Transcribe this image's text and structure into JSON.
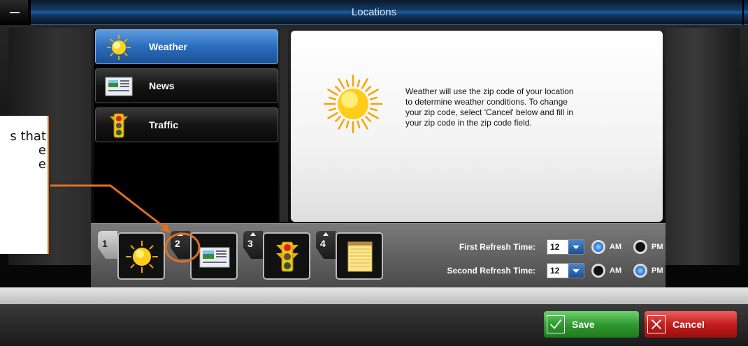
{
  "window": {
    "title": "Locations"
  },
  "feeds": [
    {
      "label": "Weather",
      "icon": "sun-icon",
      "selected": true
    },
    {
      "label": "News",
      "icon": "newspaper-icon",
      "selected": false
    },
    {
      "label": "Traffic",
      "icon": "traffic-light-icon",
      "selected": false
    }
  ],
  "description": {
    "lines": [
      "Weather will use the zip code of your location",
      "to determine weather conditions.  To change",
      "your zip code, select 'Cancel' below and fill in",
      "your zip code in the zip code field."
    ]
  },
  "slots": [
    {
      "number": "1",
      "icon": "sun-icon"
    },
    {
      "number": "2",
      "icon": "newspaper-icon"
    },
    {
      "number": "3",
      "icon": "traffic-light-icon"
    },
    {
      "number": "4",
      "icon": "notepad-icon"
    }
  ],
  "refresh": {
    "first": {
      "label": "First Refresh Time:",
      "hour": "12",
      "am_label": "AM",
      "pm_label": "PM",
      "period": "AM"
    },
    "second": {
      "label": "Second Refresh Time:",
      "hour": "12",
      "am_label": "AM",
      "pm_label": "PM",
      "period": "PM"
    }
  },
  "footer": {
    "save_label": "Save",
    "cancel_label": "Cancel"
  },
  "annotation": {
    "lines": [
      "s that",
      "e",
      "e"
    ],
    "color": "#e07020"
  },
  "colors": {
    "selected_blue": "#2a6dbd",
    "save_green": "#2f9a2f",
    "cancel_red": "#c41c1c"
  }
}
